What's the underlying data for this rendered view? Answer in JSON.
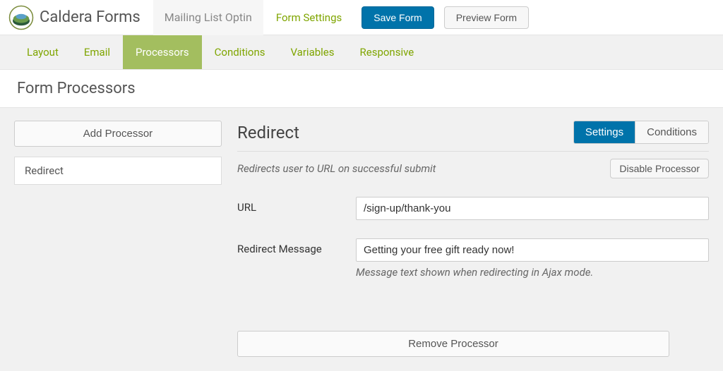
{
  "app": {
    "title": "Caldera Forms"
  },
  "topbar": {
    "form_name": "Mailing List Optin",
    "form_settings": "Form Settings",
    "save": "Save Form",
    "preview": "Preview Form"
  },
  "nav": {
    "items": [
      {
        "label": "Layout"
      },
      {
        "label": "Email"
      },
      {
        "label": "Processors"
      },
      {
        "label": "Conditions"
      },
      {
        "label": "Variables"
      },
      {
        "label": "Responsive"
      }
    ],
    "active_index": 2
  },
  "page": {
    "title": "Form Processors"
  },
  "sidebar": {
    "add_button": "Add Processor",
    "items": [
      {
        "label": "Redirect"
      }
    ]
  },
  "processor": {
    "title": "Redirect",
    "description": "Redirects user to URL on successful submit",
    "tabs": {
      "settings": "Settings",
      "conditions": "Conditions"
    },
    "disable_button": "Disable Processor",
    "fields": {
      "url": {
        "label": "URL",
        "value": "/sign-up/thank-you"
      },
      "redirect_message": {
        "label": "Redirect Message",
        "value": "Getting your free gift ready now!",
        "help": "Message text shown when redirecting in Ajax mode."
      }
    },
    "remove_button": "Remove Processor"
  }
}
